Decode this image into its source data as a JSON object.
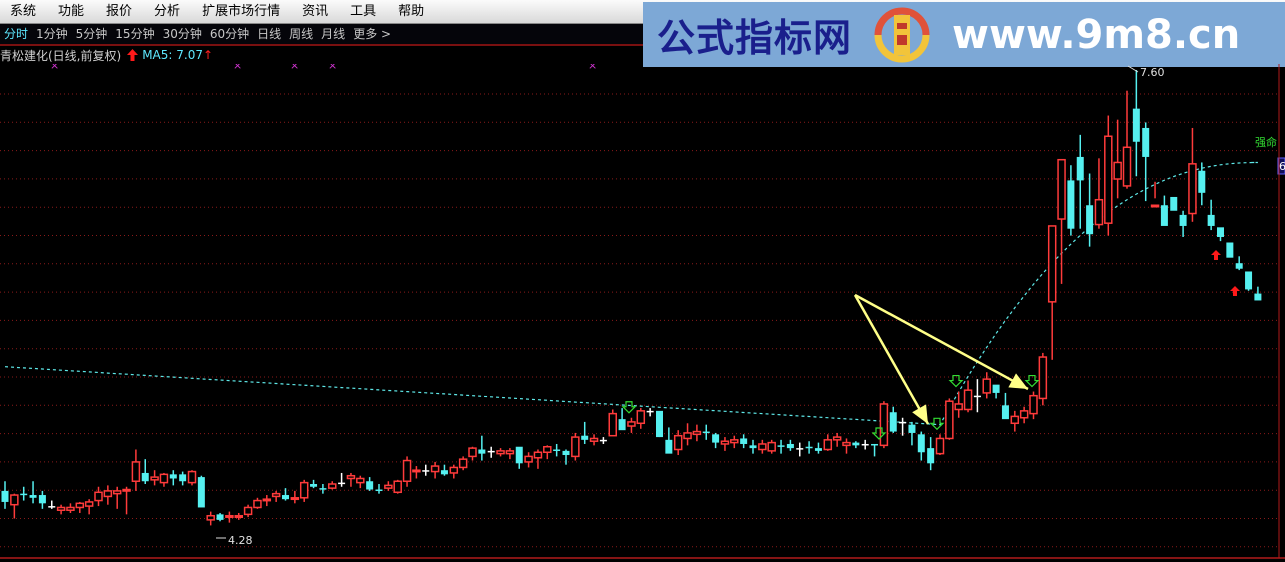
{
  "menu": [
    "系统",
    "功能",
    "报价",
    "分析",
    "扩展市场行情",
    "资讯",
    "工具",
    "帮助"
  ],
  "periods": [
    {
      "label": "分时",
      "active": true
    },
    {
      "label": "1分钟",
      "active": false
    },
    {
      "label": "5分钟",
      "active": false
    },
    {
      "label": "15分钟",
      "active": false
    },
    {
      "label": "30分钟",
      "active": false
    },
    {
      "label": "60分钟",
      "active": false
    },
    {
      "label": "日线",
      "active": false
    },
    {
      "label": "周线",
      "active": false
    },
    {
      "label": "月线",
      "active": false
    },
    {
      "label": "更多 >",
      "active": false
    }
  ],
  "title": {
    "stock": "青松建化(日线,前复权)",
    "ma_label": "MA5: 7.07",
    "up_arrow": "↑"
  },
  "banner": {
    "site_name": "公式指标网",
    "url": "www.9m8.cn",
    "logo_icon": "seal-logo-icon"
  },
  "annotations": {
    "high_label": "7.60",
    "low_label": "4.28",
    "line_label": "强命",
    "right_edge_label": "6"
  },
  "colors": {
    "up": "#ff3b3b",
    "down": "#55f0f0",
    "flat": "#ffffff",
    "ma_line": "#5ee8e8",
    "grid": "#8a1a1a",
    "arrow": "#ffff88",
    "signal_down": "#33dd33",
    "signal_up": "#ff1a1a",
    "marker": "#cc33cc"
  },
  "chart_data": {
    "type": "candlestick",
    "title": "青松建化(日线,前复权)",
    "ylim": [
      4.05,
      7.65
    ],
    "high": 7.6,
    "low": 4.28,
    "candles": [
      [
        4.55,
        4.62,
        4.42,
        4.47
      ],
      [
        4.45,
        4.53,
        4.35,
        4.52
      ],
      [
        4.53,
        4.58,
        4.48,
        4.52
      ],
      [
        4.52,
        4.62,
        4.46,
        4.5
      ],
      [
        4.52,
        4.55,
        4.42,
        4.46
      ],
      [
        4.44,
        4.48,
        4.42,
        4.44
      ],
      [
        4.41,
        4.45,
        4.38,
        4.43
      ],
      [
        4.41,
        4.46,
        4.39,
        4.43
      ],
      [
        4.43,
        4.47,
        4.39,
        4.46
      ],
      [
        4.44,
        4.49,
        4.38,
        4.47
      ],
      [
        4.48,
        4.58,
        4.44,
        4.54
      ],
      [
        4.51,
        4.59,
        4.45,
        4.55
      ],
      [
        4.53,
        4.58,
        4.42,
        4.55
      ],
      [
        4.55,
        4.58,
        4.38,
        4.56
      ],
      [
        4.62,
        4.85,
        4.55,
        4.76
      ],
      [
        4.68,
        4.78,
        4.6,
        4.62
      ],
      [
        4.63,
        4.7,
        4.59,
        4.65
      ],
      [
        4.61,
        4.68,
        4.58,
        4.67
      ],
      [
        4.67,
        4.7,
        4.59,
        4.64
      ],
      [
        4.67,
        4.69,
        4.59,
        4.62
      ],
      [
        4.61,
        4.7,
        4.59,
        4.69
      ],
      [
        4.65,
        4.66,
        4.44,
        4.43
      ],
      [
        4.34,
        4.4,
        4.3,
        4.37
      ],
      [
        4.38,
        4.39,
        4.33,
        4.34
      ],
      [
        4.36,
        4.4,
        4.32,
        4.37
      ],
      [
        4.36,
        4.39,
        4.34,
        4.37
      ],
      [
        4.38,
        4.45,
        4.36,
        4.43
      ],
      [
        4.43,
        4.5,
        4.42,
        4.48
      ],
      [
        4.48,
        4.52,
        4.44,
        4.49
      ],
      [
        4.51,
        4.55,
        4.47,
        4.53
      ],
      [
        4.52,
        4.57,
        4.48,
        4.49
      ],
      [
        4.49,
        4.55,
        4.46,
        4.5
      ],
      [
        4.5,
        4.63,
        4.47,
        4.61
      ],
      [
        4.6,
        4.63,
        4.57,
        4.58
      ],
      [
        4.57,
        4.6,
        4.53,
        4.56
      ],
      [
        4.57,
        4.62,
        4.56,
        4.6
      ],
      [
        4.61,
        4.68,
        4.58,
        4.61
      ],
      [
        4.64,
        4.68,
        4.58,
        4.66
      ],
      [
        4.61,
        4.66,
        4.57,
        4.64
      ],
      [
        4.62,
        4.65,
        4.55,
        4.56
      ],
      [
        4.56,
        4.6,
        4.53,
        4.55
      ],
      [
        4.57,
        4.62,
        4.55,
        4.59
      ],
      [
        4.54,
        4.63,
        4.53,
        4.62
      ],
      [
        4.62,
        4.8,
        4.58,
        4.77
      ],
      [
        4.69,
        4.73,
        4.64,
        4.7
      ],
      [
        4.7,
        4.74,
        4.66,
        4.7
      ],
      [
        4.69,
        4.76,
        4.64,
        4.73
      ],
      [
        4.7,
        4.74,
        4.66,
        4.67
      ],
      [
        4.68,
        4.74,
        4.64,
        4.72
      ],
      [
        4.72,
        4.8,
        4.7,
        4.78
      ],
      [
        4.8,
        4.87,
        4.77,
        4.86
      ],
      [
        4.85,
        4.95,
        4.77,
        4.82
      ],
      [
        4.84,
        4.87,
        4.79,
        4.84
      ],
      [
        4.82,
        4.86,
        4.8,
        4.84
      ],
      [
        4.82,
        4.86,
        4.78,
        4.84
      ],
      [
        4.87,
        4.86,
        4.71,
        4.75
      ],
      [
        4.76,
        4.83,
        4.72,
        4.8
      ],
      [
        4.79,
        4.85,
        4.71,
        4.83
      ],
      [
        4.83,
        4.88,
        4.78,
        4.87
      ],
      [
        4.85,
        4.89,
        4.8,
        4.84
      ],
      [
        4.84,
        4.85,
        4.74,
        4.81
      ],
      [
        4.8,
        4.97,
        4.77,
        4.94
      ],
      [
        4.95,
        5.05,
        4.89,
        4.92
      ],
      [
        4.91,
        4.96,
        4.88,
        4.93
      ],
      [
        4.92,
        4.94,
        4.89,
        4.92
      ],
      [
        4.95,
        5.14,
        4.95,
        5.11
      ],
      [
        5.07,
        5.15,
        5.02,
        4.99
      ],
      [
        5.02,
        5.08,
        4.97,
        5.05
      ],
      [
        5.04,
        5.15,
        5.0,
        5.13
      ],
      [
        5.13,
        5.15,
        5.09,
        5.13
      ],
      [
        5.13,
        5.11,
        4.94,
        4.94
      ],
      [
        4.92,
        5.01,
        4.83,
        4.82
      ],
      [
        4.85,
        4.99,
        4.81,
        4.95
      ],
      [
        4.93,
        5.04,
        4.88,
        4.97
      ],
      [
        4.96,
        5.03,
        4.91,
        4.98
      ],
      [
        4.98,
        5.03,
        4.92,
        4.97
      ],
      [
        4.96,
        4.97,
        4.86,
        4.9
      ],
      [
        4.89,
        4.94,
        4.84,
        4.91
      ],
      [
        4.9,
        4.95,
        4.86,
        4.92
      ],
      [
        4.93,
        4.96,
        4.86,
        4.89
      ],
      [
        4.88,
        4.92,
        4.82,
        4.86
      ],
      [
        4.85,
        4.92,
        4.82,
        4.89
      ],
      [
        4.84,
        4.92,
        4.82,
        4.9
      ],
      [
        4.88,
        4.92,
        4.82,
        4.87
      ],
      [
        4.89,
        4.92,
        4.84,
        4.86
      ],
      [
        4.86,
        4.9,
        4.8,
        4.86
      ],
      [
        4.87,
        4.91,
        4.82,
        4.86
      ],
      [
        4.86,
        4.9,
        4.82,
        4.84
      ],
      [
        4.85,
        4.96,
        4.84,
        4.92
      ],
      [
        4.92,
        4.97,
        4.87,
        4.94
      ],
      [
        4.88,
        4.93,
        4.82,
        4.9
      ],
      [
        4.9,
        4.91,
        4.86,
        4.88
      ],
      [
        4.89,
        4.92,
        4.85,
        4.89
      ],
      [
        4.89,
        4.89,
        4.8,
        4.88
      ],
      [
        4.88,
        5.2,
        4.86,
        5.18
      ],
      [
        5.12,
        5.16,
        4.97,
        4.98
      ],
      [
        5.05,
        5.08,
        4.95,
        5.05
      ],
      [
        5.03,
        5.05,
        4.88,
        4.97
      ],
      [
        4.96,
        4.98,
        4.77,
        4.83
      ],
      [
        4.86,
        4.94,
        4.7,
        4.75
      ],
      [
        4.82,
        4.96,
        4.81,
        4.93
      ],
      [
        4.93,
        5.22,
        4.92,
        5.2
      ],
      [
        5.14,
        5.27,
        5.08,
        5.18
      ],
      [
        5.14,
        5.35,
        5.12,
        5.28
      ],
      [
        5.24,
        5.36,
        5.12,
        5.24
      ],
      [
        5.26,
        5.41,
        5.22,
        5.36
      ],
      [
        5.32,
        5.31,
        5.22,
        5.26
      ],
      [
        5.17,
        5.26,
        5.09,
        5.07
      ],
      [
        5.04,
        5.13,
        4.98,
        5.09
      ],
      [
        5.08,
        5.16,
        5.04,
        5.13
      ],
      [
        5.11,
        5.27,
        5.07,
        5.24
      ],
      [
        5.22,
        5.55,
        5.17,
        5.52
      ],
      [
        5.92,
        6.11,
        5.5,
        6.47
      ],
      [
        6.52,
        6.82,
        6.05,
        6.95
      ],
      [
        6.8,
        6.91,
        6.4,
        6.45
      ],
      [
        6.97,
        7.13,
        6.45,
        6.8
      ],
      [
        6.62,
        6.85,
        6.32,
        6.41
      ],
      [
        6.48,
        6.96,
        6.45,
        6.66
      ],
      [
        6.49,
        7.27,
        6.4,
        7.12
      ],
      [
        6.81,
        7.24,
        6.67,
        6.93
      ],
      [
        6.76,
        7.45,
        6.74,
        7.04
      ],
      [
        7.32,
        7.6,
        6.83,
        7.08
      ],
      [
        7.18,
        7.22,
        6.65,
        6.97
      ],
      [
        6.61,
        6.79,
        6.67,
        6.62
      ],
      [
        6.62,
        6.69,
        6.57,
        6.47
      ],
      [
        6.68,
        6.68,
        6.68,
        6.58
      ],
      [
        6.55,
        6.58,
        6.39,
        6.47
      ],
      [
        6.56,
        7.18,
        6.5,
        6.92
      ],
      [
        6.87,
        6.93,
        6.62,
        6.71
      ],
      [
        6.55,
        6.66,
        6.44,
        6.47
      ],
      [
        6.46,
        6.42,
        6.36,
        6.39
      ],
      [
        6.35,
        6.32,
        6.25,
        6.24
      ],
      [
        6.2,
        6.25,
        6.15,
        6.16
      ],
      [
        6.14,
        6.09,
        6.0,
        6.01
      ],
      [
        5.98,
        6.03,
        5.96,
        5.93
      ]
    ],
    "signals_down_indexes": [
      67,
      93,
      99,
      100,
      109
    ],
    "signals_up_indexes": [
      129,
      132
    ],
    "marker_x_indexes": [
      5,
      25,
      31,
      35,
      63
    ],
    "ma_line": "slow moving average, dashed cyan, ~5.45 at left declining to ~5.03 by index 100, then rising steeply to ~6.93 at right end"
  }
}
